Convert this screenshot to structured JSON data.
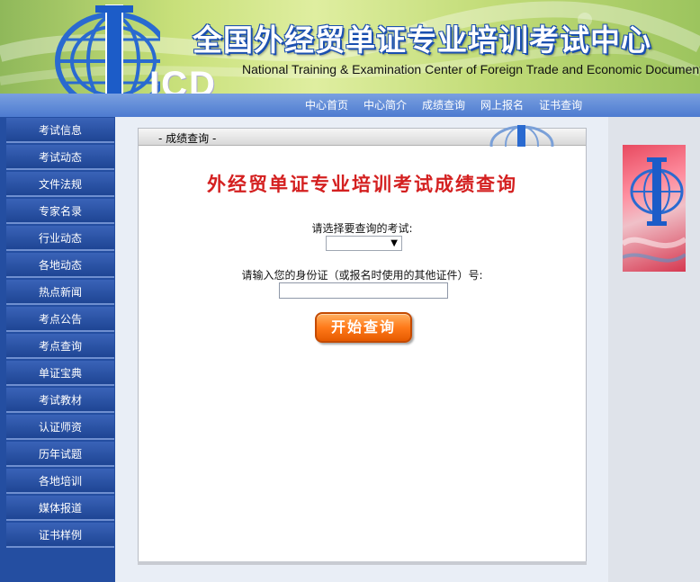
{
  "header": {
    "title_cn": "全国外经贸单证专业培训考试中心",
    "title_en": "National Training & Examination Center of Foreign Trade and Economic Documents",
    "logo_text": "ICD"
  },
  "nav": {
    "items": [
      "中心首页",
      "中心简介",
      "成绩查询",
      "网上报名",
      "证书查询"
    ]
  },
  "sidebar": {
    "items": [
      "考试信息",
      "考试动态",
      "文件法规",
      "专家名录",
      "行业动态",
      "各地动态",
      "热点新闻",
      "考点公告",
      "考点查询",
      "单证宝典",
      "考试教材",
      "认证师资",
      "历年试题",
      "各地培训",
      "媒体报道",
      "证书样例"
    ]
  },
  "panel": {
    "title": "- 成绩查询 -",
    "heading": "外经贸单证专业培训考试成绩查询",
    "exam_label": "请选择要查询的考试:",
    "exam_selected": "",
    "id_label": "请输入您的身份证（或报名时使用的其他证件）号:",
    "id_value": "",
    "submit_label": "开始查询"
  },
  "colors": {
    "nav_bg": "#4d7bd0",
    "sidebar_bg": "#244ea1",
    "heading_red": "#d42020",
    "button_orange": "#ff7a1a"
  },
  "icons": {
    "logo": "globe-logo-icon",
    "dropdown": "chevron-down-icon"
  }
}
